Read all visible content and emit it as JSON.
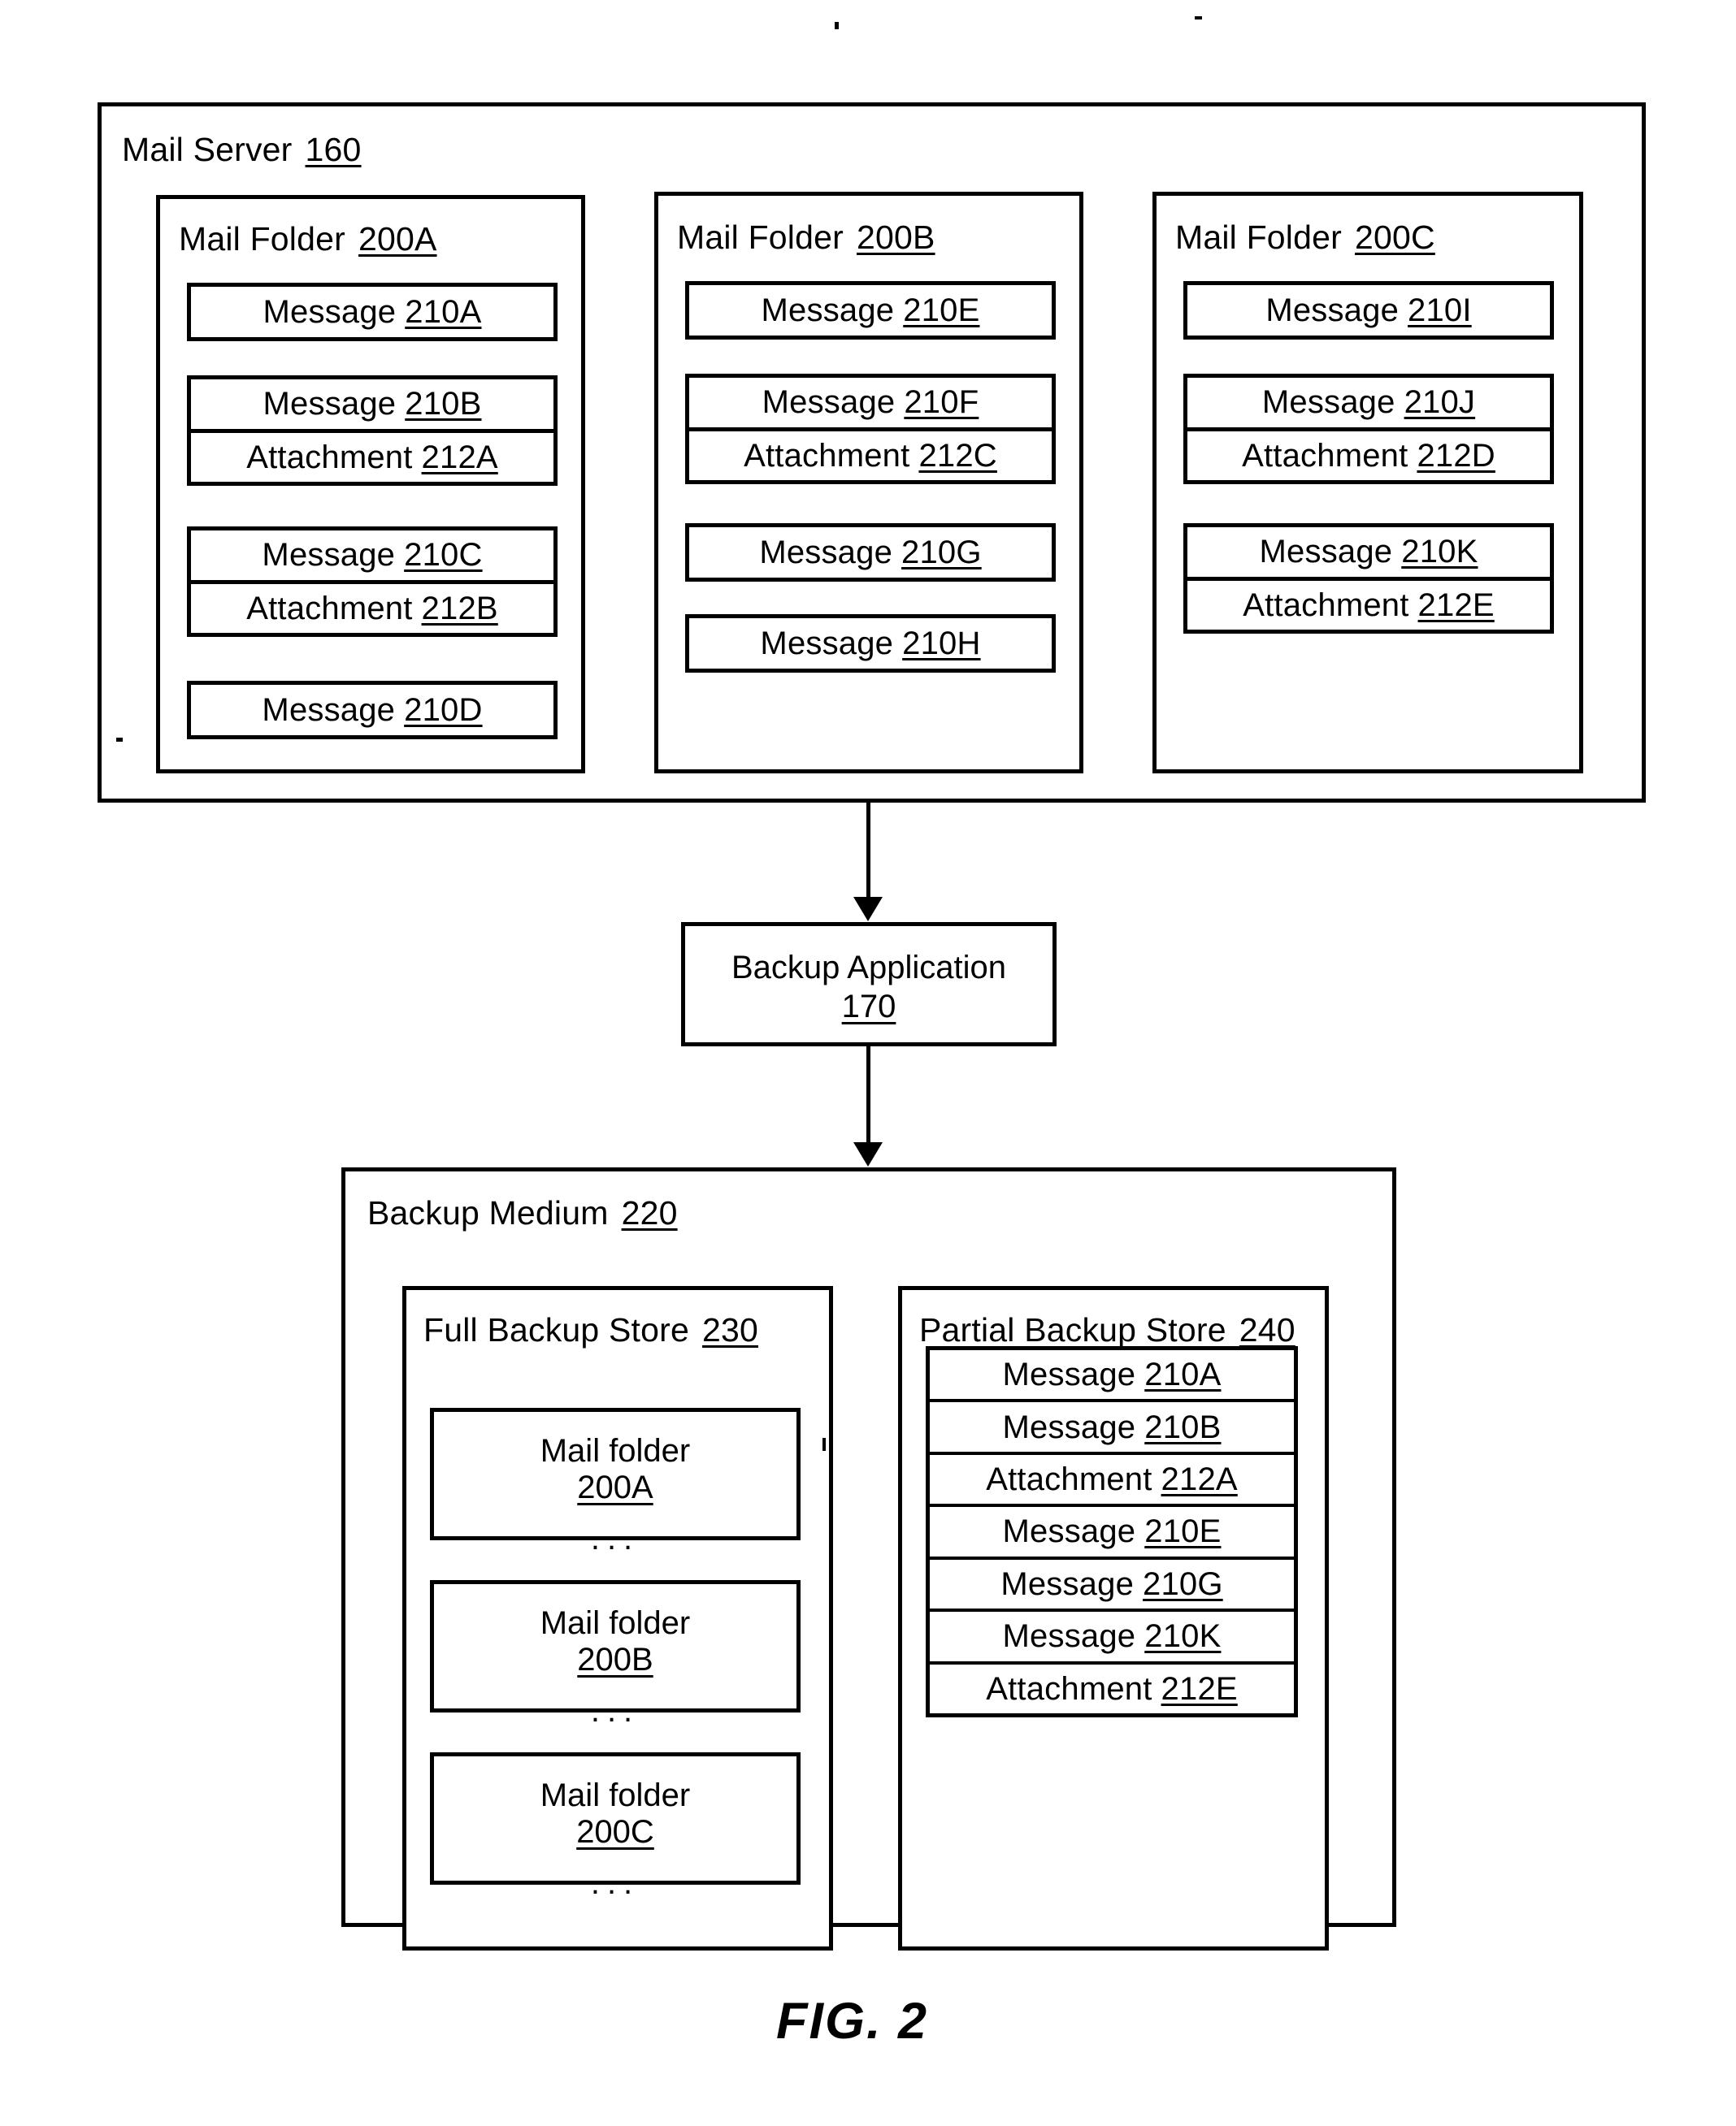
{
  "figure": {
    "caption": "FIG. 2"
  },
  "mail_server": {
    "title": "Mail Server",
    "ref": "160",
    "folders": [
      {
        "title": "Mail Folder",
        "ref": "200A",
        "items": [
          {
            "type": "single",
            "rows": [
              {
                "label": "Message",
                "ref": "210A"
              }
            ]
          },
          {
            "type": "group",
            "rows": [
              {
                "label": "Message",
                "ref": "210B"
              },
              {
                "label": "Attachment",
                "ref": "212A"
              }
            ]
          },
          {
            "type": "group",
            "rows": [
              {
                "label": "Message",
                "ref": "210C"
              },
              {
                "label": "Attachment",
                "ref": "212B"
              }
            ]
          },
          {
            "type": "single",
            "rows": [
              {
                "label": "Message",
                "ref": "210D"
              }
            ]
          }
        ]
      },
      {
        "title": "Mail Folder",
        "ref": "200B",
        "items": [
          {
            "type": "single",
            "rows": [
              {
                "label": "Message",
                "ref": "210E"
              }
            ]
          },
          {
            "type": "group",
            "rows": [
              {
                "label": "Message",
                "ref": "210F"
              },
              {
                "label": "Attachment",
                "ref": "212C"
              }
            ]
          },
          {
            "type": "single",
            "rows": [
              {
                "label": "Message",
                "ref": "210G"
              }
            ]
          },
          {
            "type": "single",
            "rows": [
              {
                "label": "Message",
                "ref": "210H"
              }
            ]
          }
        ]
      },
      {
        "title": "Mail Folder",
        "ref": "200C",
        "items": [
          {
            "type": "single",
            "rows": [
              {
                "label": "Message",
                "ref": "210I"
              }
            ]
          },
          {
            "type": "group",
            "rows": [
              {
                "label": "Message",
                "ref": "210J"
              },
              {
                "label": "Attachment",
                "ref": "212D"
              }
            ]
          },
          {
            "type": "group",
            "rows": [
              {
                "label": "Message",
                "ref": "210K"
              },
              {
                "label": "Attachment",
                "ref": "212E"
              }
            ]
          }
        ]
      }
    ]
  },
  "backup_application": {
    "title": "Backup Application",
    "ref": "170"
  },
  "backup_medium": {
    "title": "Backup Medium",
    "ref": "220",
    "full_backup_store": {
      "title": "Full Backup Store",
      "ref": "230",
      "folders": [
        {
          "name": "Mail folder",
          "ref": "200A",
          "dots": "..."
        },
        {
          "name": "Mail folder",
          "ref": "200B",
          "dots": "..."
        },
        {
          "name": "Mail folder",
          "ref": "200C",
          "dots": "..."
        }
      ]
    },
    "partial_backup_store": {
      "title": "Partial Backup Store",
      "ref": "240",
      "rows": [
        {
          "label": "Message",
          "ref": "210A"
        },
        {
          "label": "Message",
          "ref": "210B"
        },
        {
          "label": "Attachment",
          "ref": "212A"
        },
        {
          "label": "Message",
          "ref": "210E"
        },
        {
          "label": "Message",
          "ref": "210G"
        },
        {
          "label": "Message",
          "ref": "210K"
        },
        {
          "label": "Attachment",
          "ref": "212E"
        }
      ]
    }
  }
}
